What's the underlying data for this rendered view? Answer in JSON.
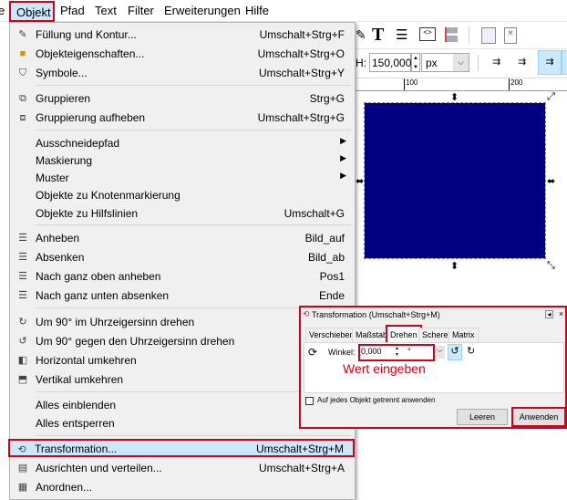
{
  "menubar": {
    "items": [
      "e",
      "Objekt",
      "Pfad",
      "Text",
      "Filter",
      "Erweiterungen",
      "Hilfe"
    ]
  },
  "toolbar": {
    "h_label": "H:",
    "h_value": "150,000",
    "unit": "px"
  },
  "ruler": {
    "ticks": [
      "100",
      "200"
    ]
  },
  "menu": {
    "items": [
      {
        "label": "Füllung und Kontur...",
        "shortcut": "Umschalt+Strg+F",
        "icon": "fill-stroke-icon"
      },
      {
        "label": "Objekteigenschaften...",
        "shortcut": "Umschalt+Strg+O",
        "icon": "object-properties-icon"
      },
      {
        "label": "Symbole...",
        "shortcut": "Umschalt+Strg+Y",
        "icon": "symbols-icon"
      },
      {
        "label": "Gruppieren",
        "shortcut": "Strg+G",
        "icon": "group-icon"
      },
      {
        "label": "Gruppierung aufheben",
        "shortcut": "Umschalt+Strg+G",
        "icon": "ungroup-icon"
      },
      {
        "label": "Ausschneidepfad",
        "shortcut": "",
        "submenu": true
      },
      {
        "label": "Maskierung",
        "shortcut": "",
        "submenu": true
      },
      {
        "label": "Muster",
        "shortcut": "",
        "submenu": true
      },
      {
        "label": "Objekte zu Knotenmarkierung",
        "shortcut": ""
      },
      {
        "label": "Objekte zu Hilfslinien",
        "shortcut": "Umschalt+G"
      },
      {
        "label": "Anheben",
        "shortcut": "Bild_auf",
        "icon": "raise-icon"
      },
      {
        "label": "Absenken",
        "shortcut": "Bild_ab",
        "icon": "lower-icon"
      },
      {
        "label": "Nach ganz oben anheben",
        "shortcut": "Pos1",
        "icon": "raise-top-icon"
      },
      {
        "label": "Nach ganz unten absenken",
        "shortcut": "Ende",
        "icon": "lower-bottom-icon"
      },
      {
        "label": "Um 90° im Uhrzeigersinn drehen",
        "shortcut": "",
        "icon": "rotate-cw-icon"
      },
      {
        "label": "Um 90° gegen den Uhrzeigersinn drehen",
        "shortcut": "",
        "icon": "rotate-ccw-icon"
      },
      {
        "label": "Horizontal umkehren",
        "shortcut": "",
        "icon": "flip-horizontal-icon"
      },
      {
        "label": "Vertikal umkehren",
        "shortcut": "",
        "icon": "flip-vertical-icon"
      },
      {
        "label": "Alles einblenden",
        "shortcut": ""
      },
      {
        "label": "Alles entsperren",
        "shortcut": ""
      },
      {
        "label": "Transformation...",
        "shortcut": "Umschalt+Strg+M",
        "icon": "transform-icon"
      },
      {
        "label": "Ausrichten und verteilen...",
        "shortcut": "Umschalt+Strg+A",
        "icon": "align-icon"
      },
      {
        "label": "Anordnen...",
        "shortcut": "",
        "icon": "arrange-icon"
      }
    ]
  },
  "dialog": {
    "title": "Transformation (Umschalt+Strg+M)",
    "tabs": [
      "Verschieben",
      "Maßstab",
      "Drehen",
      "Scheren",
      "Matrix"
    ],
    "angle_label": "Winkel:",
    "angle_value": "0,000",
    "angle_unit": "°",
    "annotation": "Wert eingeben",
    "checkbox_label": "Auf jedes Objekt getrennt anwenden",
    "clear_label": "Leeren",
    "apply_label": "Anwenden"
  },
  "colors": {
    "highlight": "#d0021b",
    "object": "#000080",
    "selection": "#cce8ff"
  }
}
